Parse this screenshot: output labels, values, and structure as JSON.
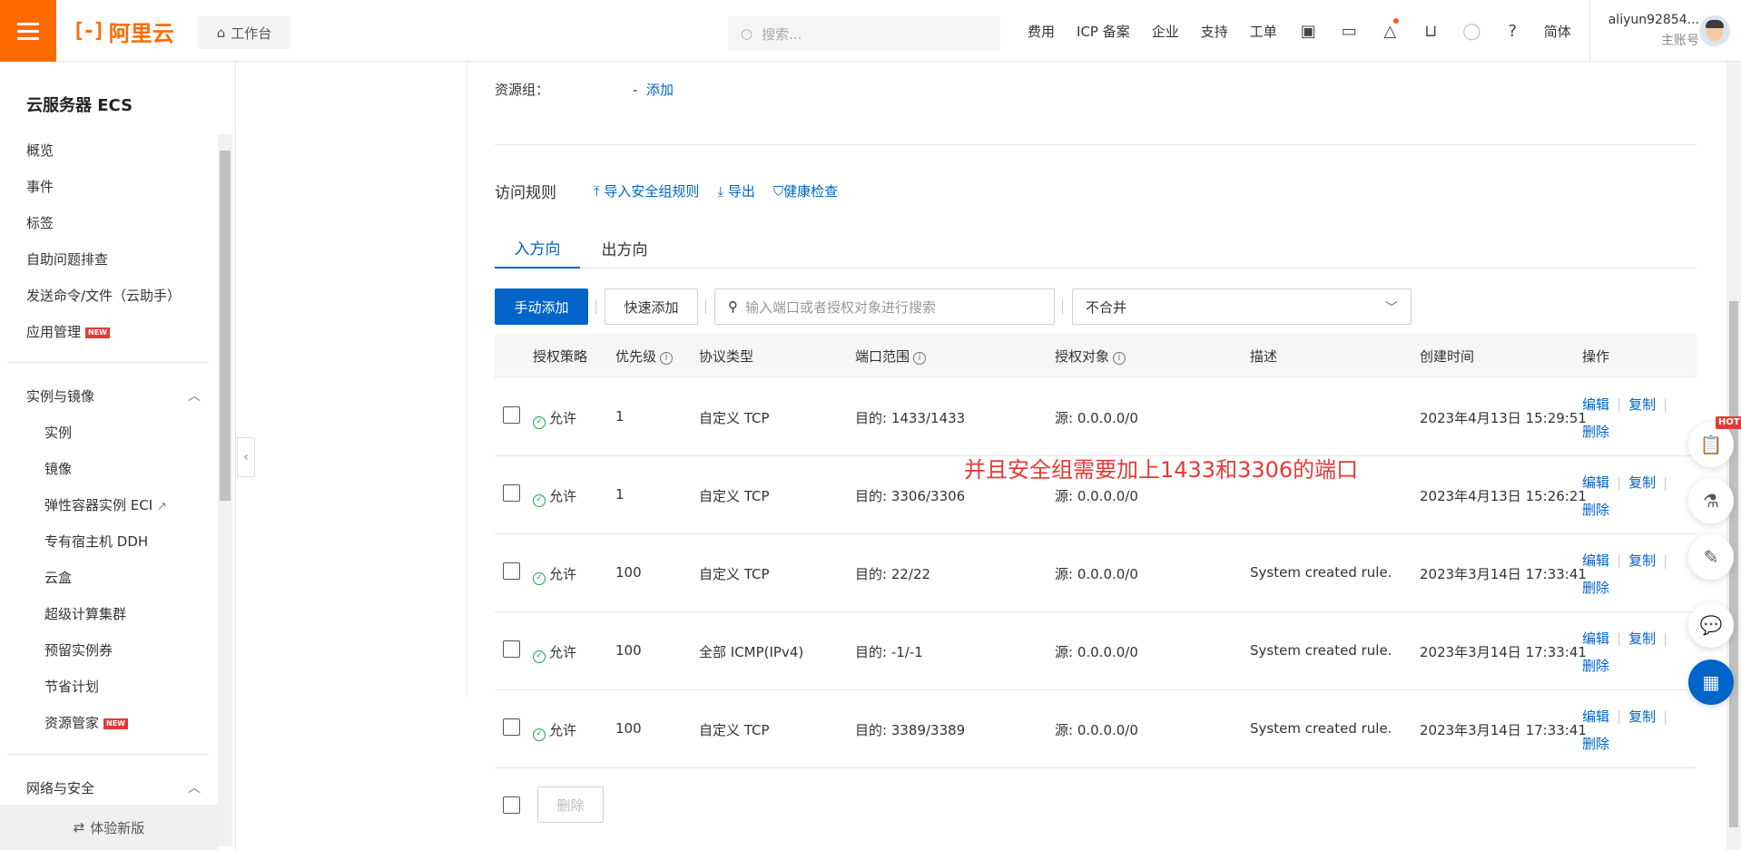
{
  "topbar": {
    "brand": "阿里云",
    "workbench": "工作台",
    "search_placeholder": "搜索...",
    "nav": [
      "费用",
      "ICP 备案",
      "企业",
      "支持",
      "工单"
    ],
    "lang": "简体",
    "username": "aliyun92854...",
    "account_type": "主账号"
  },
  "sidebar": {
    "title": "云服务器 ECS",
    "items": [
      "概览",
      "事件",
      "标签",
      "自助问题排查",
      "发送命令/文件（云助手）",
      "应用管理"
    ],
    "new_badge": "NEW",
    "group1": "实例与镜像",
    "group1_items": [
      "实例",
      "镜像",
      "弹性容器实例 ECI",
      "专有宿主机 DDH",
      "云盒",
      "超级计算集群",
      "预留实例券",
      "节省计划",
      "资源管家"
    ],
    "group2": "网络与安全",
    "footer": "体验新版"
  },
  "main": {
    "resource_group_label": "资源组：",
    "resource_group_value": "-",
    "resource_group_add": "添加",
    "rules_title": "访问规则",
    "import_link": "导入安全组规则",
    "export_link": "导出",
    "health_link": "健康检查",
    "tabs": [
      "入方向",
      "出方向"
    ],
    "btn_manual_add": "手动添加",
    "btn_quick_add": "快速添加",
    "search_placeholder": "输入端口或者授权对象进行搜索",
    "merge_select": "不合并",
    "columns": [
      "授权策略",
      "优先级",
      "协议类型",
      "端口范围",
      "授权对象",
      "描述",
      "创建时间",
      "操作"
    ],
    "rows": [
      {
        "policy": "允许",
        "priority": "1",
        "protocol": "自定义 TCP",
        "port": "目的: 1433/1433",
        "target": "源: 0.0.0.0/0",
        "desc": "",
        "created": "2023年4月13日 15:29:51"
      },
      {
        "policy": "允许",
        "priority": "1",
        "protocol": "自定义 TCP",
        "port": "目的: 3306/3306",
        "target": "源: 0.0.0.0/0",
        "desc": "",
        "created": "2023年4月13日 15:26:21"
      },
      {
        "policy": "允许",
        "priority": "100",
        "protocol": "自定义 TCP",
        "port": "目的: 22/22",
        "target": "源: 0.0.0.0/0",
        "desc": "System created rule.",
        "created": "2023年3月14日 17:33:41"
      },
      {
        "policy": "允许",
        "priority": "100",
        "protocol": "全部 ICMP(IPv4)",
        "port": "目的: -1/-1",
        "target": "源: 0.0.0.0/0",
        "desc": "System created rule.",
        "created": "2023年3月14日 17:33:41"
      },
      {
        "policy": "允许",
        "priority": "100",
        "protocol": "自定义 TCP",
        "port": "目的: 3389/3389",
        "target": "源: 0.0.0.0/0",
        "desc": "System created rule.",
        "created": "2023年3月14日 17:33:41"
      }
    ],
    "op_edit": "编辑",
    "op_copy": "复制",
    "op_delete": "删除",
    "btn_bulk_delete": "删除",
    "annotation": "并且安全组需要加上1433和3306的端口"
  },
  "floating": {
    "hot_badge": "HOT"
  },
  "colors": {
    "brand": "#ff6a00",
    "link": "#0064c8",
    "annotation": "#e53935"
  }
}
